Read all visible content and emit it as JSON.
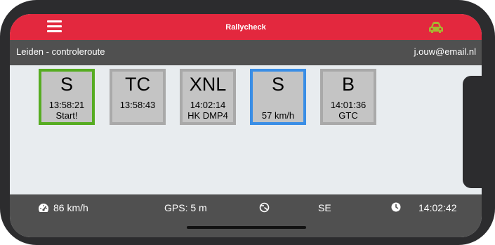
{
  "app": {
    "title": "Rallycheck"
  },
  "icons": {
    "menu": "hamburger-menu-icon",
    "car": "car-icon",
    "speed": "speedometer-icon",
    "heading": "compass-icon",
    "clock": "clock-icon"
  },
  "colors": {
    "accent": "#e3283e",
    "bar": "#505050",
    "car_icon": "#a6b830",
    "selected_green": "#56ac22",
    "selected_blue": "#3a8ee6",
    "card": "#c4c4c4"
  },
  "subheader": {
    "route": "Leiden - controleroute",
    "email": "j.ouw@email.nl"
  },
  "controls": [
    {
      "code": "S",
      "time": "13:58:21",
      "note": "Start!",
      "style": "green"
    },
    {
      "code": "TC",
      "time": "13:58:43",
      "note": "",
      "style": "normal"
    },
    {
      "code": "XNL",
      "time": "14:02:14",
      "note": "HK DMP4",
      "style": "normal"
    },
    {
      "code": "S",
      "time": "",
      "note": "57 km/h",
      "style": "blue"
    },
    {
      "code": "B",
      "time": "14:01:36",
      "note": "GTC",
      "style": "normal"
    }
  ],
  "status": {
    "speed": "86 km/h",
    "gps": "GPS: 5 m",
    "heading": "SE",
    "clock": "14:02:42"
  }
}
